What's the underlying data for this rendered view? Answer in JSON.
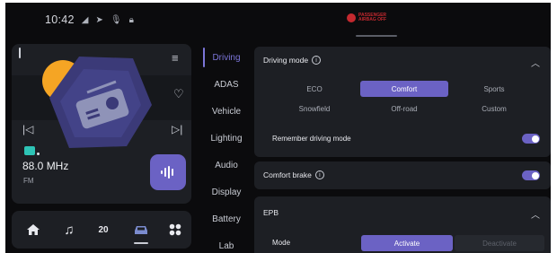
{
  "status_bar": {
    "time": "10:42"
  },
  "airbag_indicator": {
    "text": "PASSENGER AIRBAG OFF",
    "color": "#c4292f"
  },
  "media": {
    "frequency": "88.0 MHz",
    "band": "FM"
  },
  "dock": {
    "temperature": "20"
  },
  "side_menu": {
    "items": [
      "Driving",
      "ADAS",
      "Vehicle",
      "Lighting",
      "Audio",
      "Display",
      "Battery",
      "Lab"
    ],
    "active": "Driving"
  },
  "driving_mode": {
    "title": "Driving mode",
    "options": [
      "ECO",
      "Comfort",
      "Sports",
      "Snowfield",
      "Off-road",
      "Custom"
    ],
    "selected": "Comfort",
    "remember_label": "Remember driving mode",
    "remember_on": true
  },
  "comfort_brake": {
    "label": "Comfort brake",
    "on": true
  },
  "epb": {
    "title": "EPB",
    "mode_label": "Mode",
    "activate_label": "Activate",
    "deactivate_label": "Deactivate"
  },
  "colors": {
    "accent": "#6b62c4",
    "accent_text": "#7b75d8",
    "radio_tile": "#f5a524",
    "panel": "#1d1f24",
    "background": "#0b0b0d"
  }
}
